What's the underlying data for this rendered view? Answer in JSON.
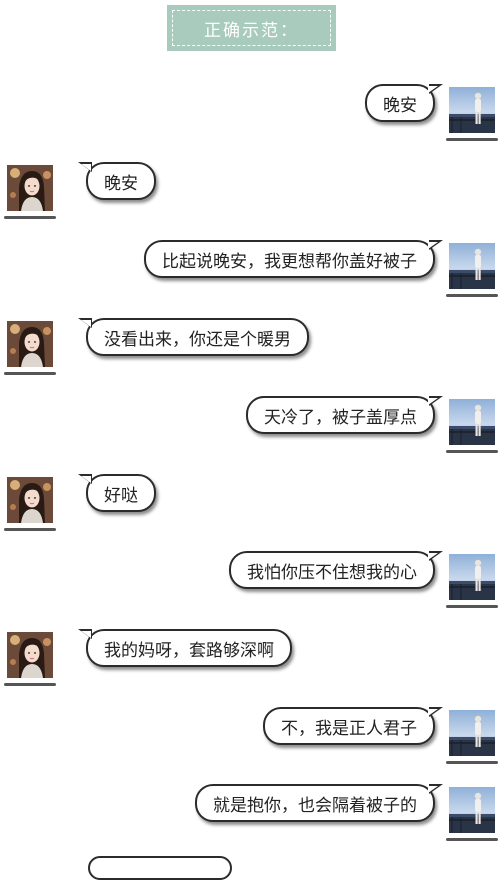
{
  "banner": {
    "text": "正确示范："
  },
  "messages": [
    {
      "side": "right",
      "text": "晚安"
    },
    {
      "side": "left",
      "text": "晚安"
    },
    {
      "side": "right",
      "text": "比起说晚安，我更想帮你盖好被子"
    },
    {
      "side": "left",
      "text": "没看出来，你还是个暖男"
    },
    {
      "side": "right",
      "text": "天冷了，被子盖厚点"
    },
    {
      "side": "left",
      "text": "好哒"
    },
    {
      "side": "right",
      "text": "我怕你压不住想我的心"
    },
    {
      "side": "left",
      "text": "我的妈呀，套路够深啊"
    },
    {
      "side": "right",
      "text": "不，我是正人君子"
    },
    {
      "side": "right",
      "text": "就是抱你，也会隔着被子的"
    }
  ],
  "icons": {
    "male_avatar": "male-avatar-icon",
    "female_avatar": "female-avatar-icon"
  }
}
